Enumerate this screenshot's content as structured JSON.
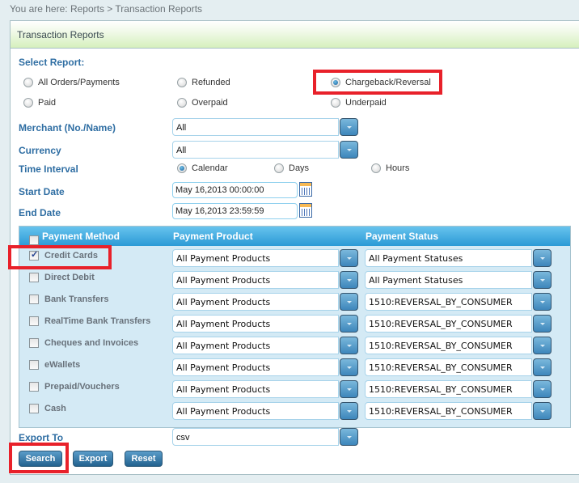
{
  "breadcrumb": "You are here: Reports > Transaction Reports",
  "panel_title": "Transaction Reports",
  "select_report": {
    "label": "Select Report:",
    "options": [
      {
        "label": "All Orders/Payments",
        "checked": false
      },
      {
        "label": "Refunded",
        "checked": false
      },
      {
        "label": "Chargeback/Reversal",
        "checked": true
      },
      {
        "label": "Paid",
        "checked": false
      },
      {
        "label": "Overpaid",
        "checked": false
      },
      {
        "label": "Underpaid",
        "checked": false
      }
    ]
  },
  "merchant": {
    "label": "Merchant (No./Name)",
    "value": "All"
  },
  "currency": {
    "label": "Currency",
    "value": "All"
  },
  "time_interval": {
    "label": "Time Interval",
    "options": [
      {
        "label": "Calendar",
        "checked": true
      },
      {
        "label": "Days",
        "checked": false
      },
      {
        "label": "Hours",
        "checked": false
      }
    ]
  },
  "start_date": {
    "label": "Start Date",
    "value": "May 16,2013 00:00:00"
  },
  "end_date": {
    "label": "End Date",
    "value": "May 16,2013 23:59:59"
  },
  "payment_table": {
    "headers": {
      "method": "Payment Method",
      "product": "Payment Product",
      "status": "Payment Status"
    },
    "rows": [
      {
        "method": "Credit Cards",
        "checked": true,
        "product": "All Payment Products",
        "status": "All Payment Statuses"
      },
      {
        "method": "Direct Debit",
        "checked": false,
        "product": "All Payment Products",
        "status": "All Payment Statuses"
      },
      {
        "method": "Bank Transfers",
        "checked": false,
        "product": "All Payment Products",
        "status": "1510:REVERSAL_BY_CONSUMER"
      },
      {
        "method": "RealTime Bank Transfers",
        "checked": false,
        "product": "All Payment Products",
        "status": "1510:REVERSAL_BY_CONSUMER"
      },
      {
        "method": "Cheques and Invoices",
        "checked": false,
        "product": "All Payment Products",
        "status": "1510:REVERSAL_BY_CONSUMER"
      },
      {
        "method": "eWallets",
        "checked": false,
        "product": "All Payment Products",
        "status": "1510:REVERSAL_BY_CONSUMER"
      },
      {
        "method": "Prepaid/Vouchers",
        "checked": false,
        "product": "All Payment Products",
        "status": "1510:REVERSAL_BY_CONSUMER"
      },
      {
        "method": "Cash",
        "checked": false,
        "product": "All Payment Products",
        "status": "1510:REVERSAL_BY_CONSUMER"
      }
    ]
  },
  "export_to": {
    "label": "Export To",
    "value": "csv"
  },
  "buttons": {
    "search": "Search",
    "export": "Export",
    "reset": "Reset"
  },
  "colors": {
    "highlight": "#e8212a",
    "label_blue": "#2f6ea3",
    "header_blue": "#2b9ad6"
  }
}
